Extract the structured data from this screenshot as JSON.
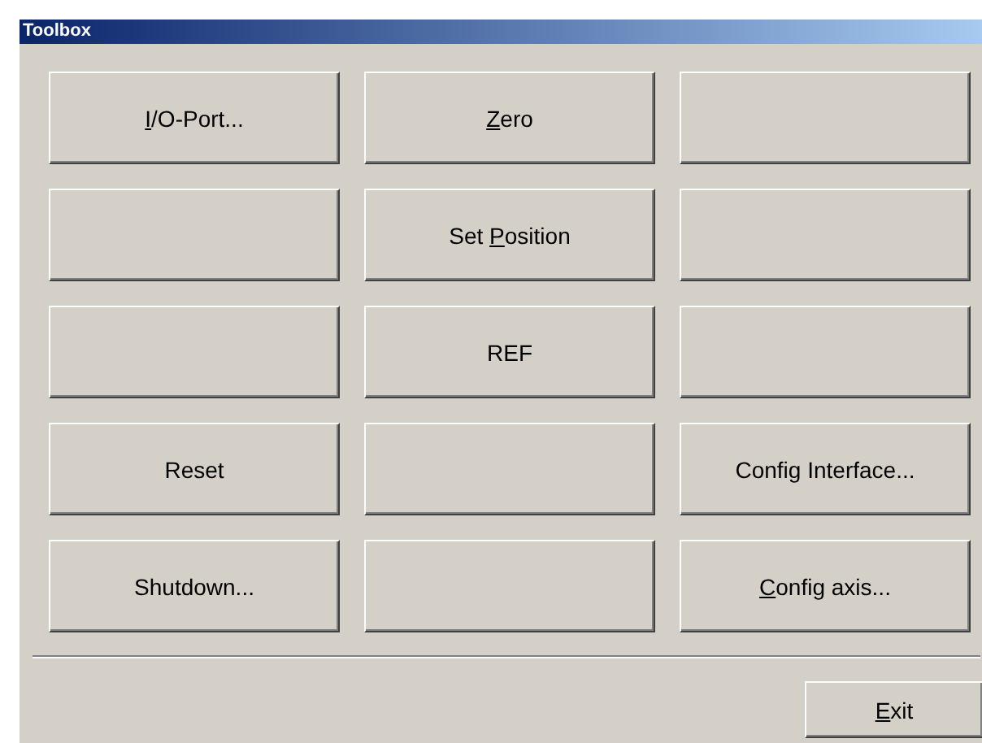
{
  "window": {
    "title": "Toolbox"
  },
  "buttons": [
    {
      "kind": "label",
      "key": "I",
      "after": "/O-Port..."
    },
    {
      "kind": "label",
      "key": "Z",
      "after": "ero"
    },
    {
      "kind": "blank"
    },
    {
      "kind": "blank"
    },
    {
      "kind": "label",
      "before": "Set ",
      "key": "P",
      "after": "osition"
    },
    {
      "kind": "blank"
    },
    {
      "kind": "blank"
    },
    {
      "kind": "label",
      "before": "REF"
    },
    {
      "kind": "blank"
    },
    {
      "kind": "label",
      "before": "Reset"
    },
    {
      "kind": "blank"
    },
    {
      "kind": "label",
      "before": "Config Interface..."
    },
    {
      "kind": "label",
      "before": "Shutdown..."
    },
    {
      "kind": "blank"
    },
    {
      "kind": "label",
      "key": "C",
      "after": "onfig axis..."
    }
  ],
  "exit": {
    "key": "E",
    "after": "xit"
  }
}
